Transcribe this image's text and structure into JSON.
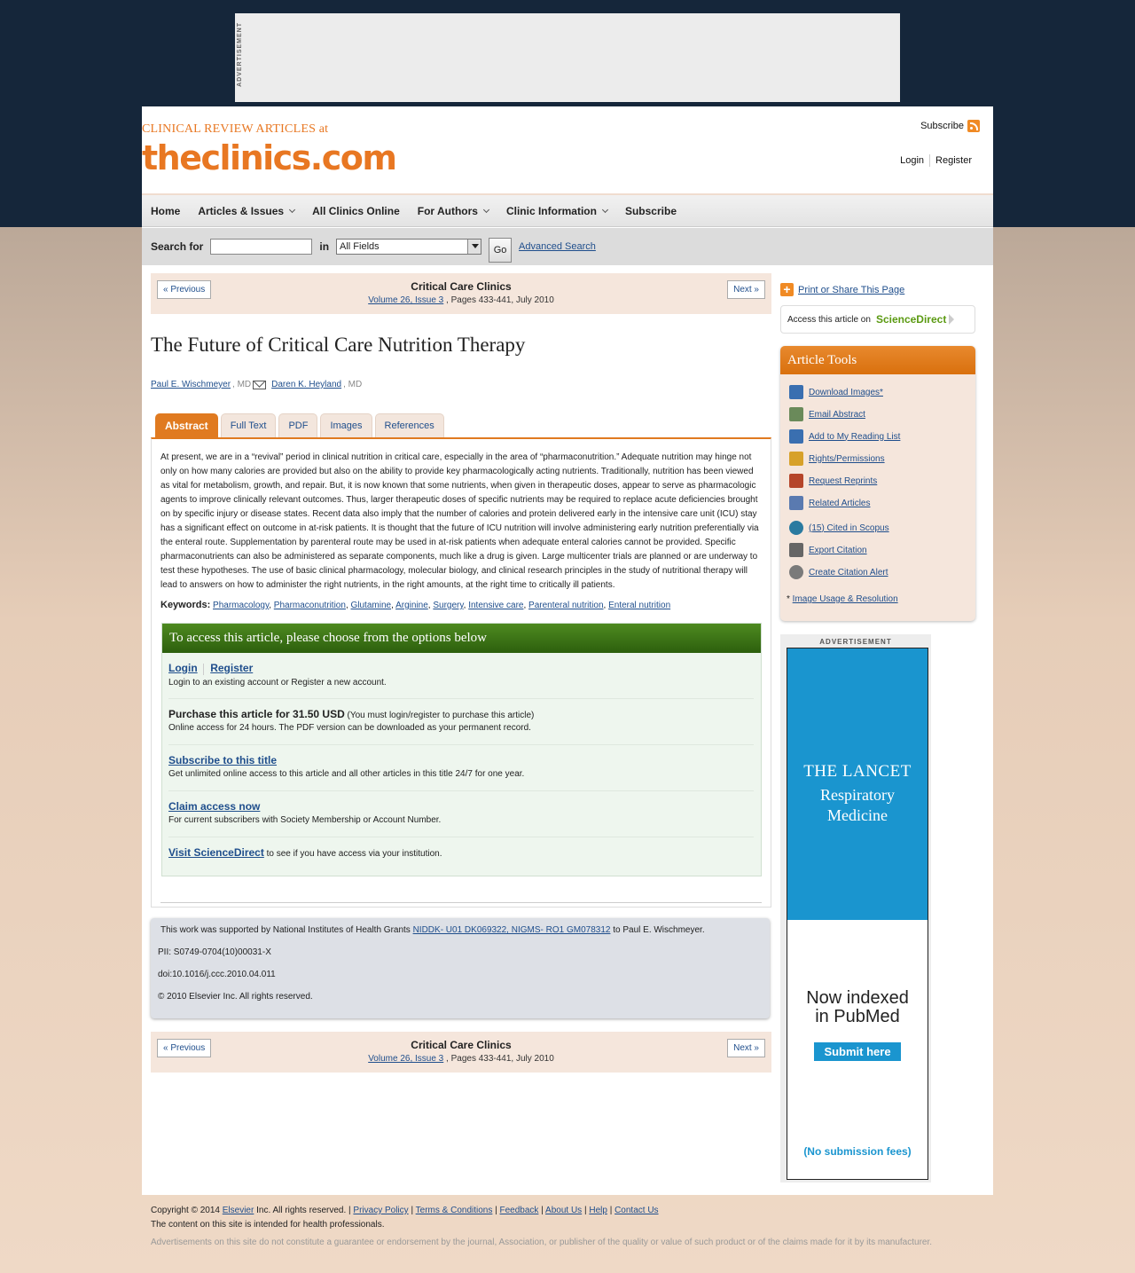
{
  "top_ad": {
    "label": "ADVERTISEMENT"
  },
  "header": {
    "logo_small": "CLINICAL REVIEW ARTICLES at",
    "logo_big": "theclinics.com",
    "subscribe": "Subscribe",
    "login": "Login",
    "register": "Register"
  },
  "nav": {
    "items": [
      {
        "label": "Home"
      },
      {
        "label": "Articles & Issues"
      },
      {
        "label": "All Clinics Online"
      },
      {
        "label": "For Authors"
      },
      {
        "label": "Clinic Information"
      },
      {
        "label": "Subscribe"
      }
    ]
  },
  "search": {
    "label": "Search for",
    "in_label": "in",
    "field_value": "All Fields",
    "go": "Go",
    "advanced": "Advanced Search"
  },
  "article_nav": {
    "prev": "« Previous",
    "next": "Next »",
    "journal": "Critical Care Clinics",
    "volume_link": "Volume 26, Issue 3",
    "pages": ", Pages 433-441, July 2010"
  },
  "article": {
    "title": "The Future of Critical Care Nutrition Therapy",
    "author1": "Paul E. Wischmeyer",
    "author1_deg": ", MD",
    "author2": "Daren K. Heyland",
    "author2_deg": ", MD",
    "tabs": [
      "Abstract",
      "Full Text",
      "PDF",
      "Images",
      "References"
    ],
    "abstract": "At present, we are in a “revival” period in clinical nutrition in critical care, especially in the area of “pharmaconutrition.” Adequate nutrition may hinge not only on how many calories are provided but also on the ability to provide key pharmacologically acting nutrients. Traditionally, nutrition has been viewed as vital for metabolism, growth, and repair. But, it is now known that some nutrients, when given in therapeutic doses, appear to serve as pharmacologic agents to improve clinically relevant outcomes. Thus, larger therapeutic doses of specific nutrients may be required to replace acute deficiencies brought on by specific injury or disease states. Recent data also imply that the number of calories and protein delivered early in the intensive care unit (ICU) stay has a significant effect on outcome in at-risk patients. It is thought that the future of ICU nutrition will involve administering early nutrition preferentially via the enteral route. Supplementation by parenteral route may be used in at-risk patients when adequate enteral calories cannot be provided. Specific pharmaconutrients can also be administered as separate components, much like a drug is given. Large multicenter trials are planned or are underway to test these hypotheses. The use of basic clinical pharmacology, molecular biology, and clinical research principles in the study of nutritional therapy will lead to answers on how to administer the right nutrients, in the right amounts, at the right time to critically ill patients.",
    "keywords_label": "Keywords:",
    "keywords": [
      "Pharmacology",
      "Pharmaconutrition",
      "Glutamine",
      "Arginine",
      "Surgery",
      "Intensive care",
      "Parenteral nutrition",
      "Enteral nutrition"
    ]
  },
  "access": {
    "heading": "To access this article, please choose from the options below",
    "login": "Login",
    "register": "Register",
    "login_desc": "Login to an existing account or Register a new account.",
    "purchase": "Purchase this article for 31.50 USD",
    "purchase_note": "(You must login/register to purchase this article)",
    "purchase_desc": "Online access for 24 hours. The PDF version can be downloaded as your permanent record.",
    "subscribe": "Subscribe to this title",
    "subscribe_desc": "Get unlimited online access to this article and all other articles in this title 24/7 for one year.",
    "claim": "Claim access now",
    "claim_desc": "For current subscribers with Society Membership or Account Number.",
    "visit": "Visit ScienceDirect",
    "visit_desc": "to see if you have access via your institution."
  },
  "info": {
    "support_pre": "This work was supported by National Institutes of Health Grants",
    "support_link": "NIDDK- U01 DK069322, NIGMS- RO1 GM078312",
    "support_post": "to Paul E. Wischmeyer.",
    "pii": "PII: S0749-0704(10)00031-X",
    "doi": "doi:10.1016/j.ccc.2010.04.011",
    "copyright": "© 2010 Elsevier Inc. All rights reserved."
  },
  "sidebar": {
    "print_share": "Print or Share This Page",
    "access_on": "Access this article on",
    "sciencedirect": "ScienceDirect",
    "tools_title": "Article Tools",
    "tools": [
      {
        "label": "Download Images*",
        "icon": "save-icon",
        "color": "#3a6fb0"
      },
      {
        "label": "Email Abstract",
        "icon": "email-icon",
        "color": "#6a8a5a"
      },
      {
        "label": "Add to My Reading List",
        "icon": "reading-list-icon",
        "color": "#3a6fb0"
      },
      {
        "label": "Rights/Permissions",
        "icon": "lock-icon",
        "color": "#d7a12a"
      },
      {
        "label": "Request Reprints",
        "icon": "reprints-icon",
        "color": "#b5452a"
      },
      {
        "label": "Related Articles",
        "icon": "related-articles-icon",
        "color": "#5a7ab0"
      },
      {
        "label": "(15) Cited in Scopus",
        "icon": "scopus-icon",
        "color": "#2a7aa0"
      },
      {
        "label": "Export Citation",
        "icon": "export-icon",
        "color": "#666666"
      },
      {
        "label": "Create Citation Alert",
        "icon": "alert-icon",
        "color": "#7a7a7a"
      }
    ],
    "image_usage": "Image Usage & Resolution",
    "ad_label": "ADVERTISEMENT",
    "ad_l1": "THE LANCET",
    "ad_l2": "Respiratory",
    "ad_l3": "Medicine",
    "ad_pm1": "Now indexed",
    "ad_pm2": "in PubMed",
    "ad_submit": "Submit here",
    "ad_nofee": "(No submission fees)"
  },
  "footer": {
    "copy_pre": "Copyright © 2014",
    "elsevier": "Elsevier",
    "copy_post": "Inc. All rights reserved. |",
    "links": [
      "Privacy Policy",
      "Terms & Conditions",
      "Feedback",
      "About Us",
      "Help",
      "Contact Us"
    ],
    "line2": "The content on this site is intended for health professionals.",
    "line3": "Advertisements on this site do not constitute a guarantee or endorsement by the journal, Association, or publisher of the quality or value of such product or of the claims made for it by its manufacturer."
  },
  "colors": {
    "accent_orange": "#e07a20",
    "link_blue": "#1f4e8c",
    "access_green": "#3f7a18",
    "lancet_blue": "#1a95cf"
  }
}
